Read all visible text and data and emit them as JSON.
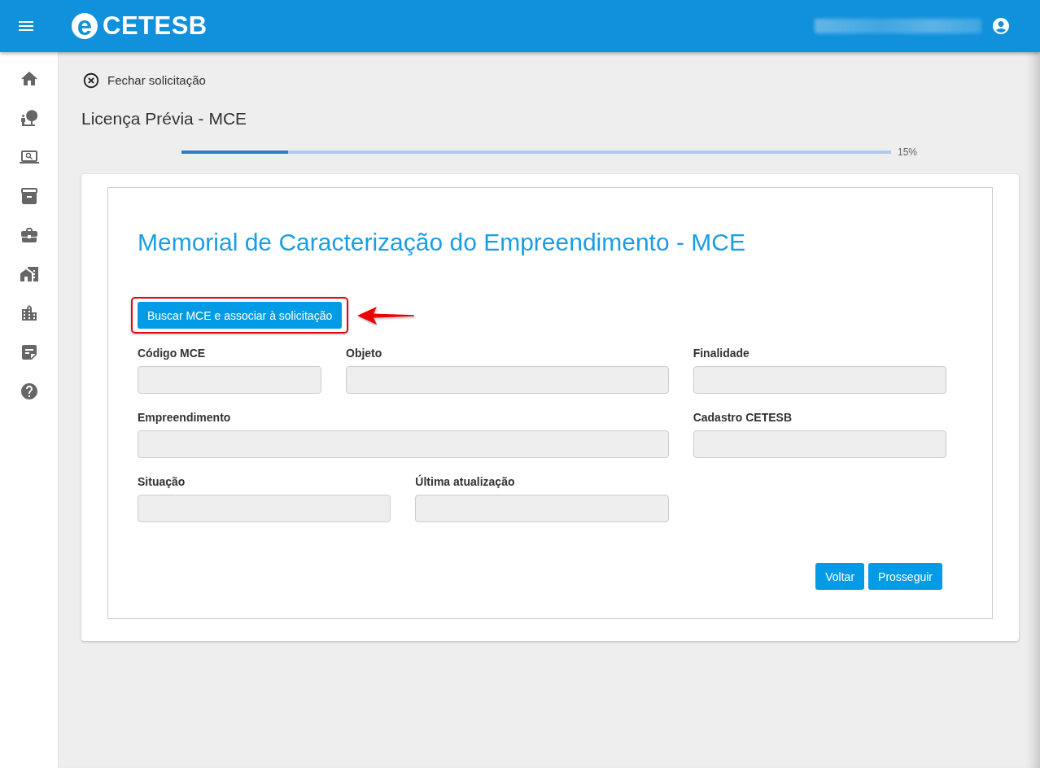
{
  "header": {
    "logo": {
      "mark": "e",
      "name": "CETESB"
    },
    "account": {
      "email_blurred": true
    }
  },
  "close_link": {
    "label": "Fechar solicitação"
  },
  "page_title": "Licença Prévia - MCE",
  "progress": {
    "level": 0.15,
    "reading": "15%"
  },
  "form": {
    "title": "Memorial de Caracterização do Empreendimento - MCE",
    "search_button": {
      "label": "Buscar MCE e associar à solicitação",
      "highlighted": true
    },
    "rows": [
      {
        "fields": [
          {
            "label": "Código MCE",
            "disabled": true
          },
          {
            "label": "Objeto",
            "disabled": true
          },
          {
            "label": "Finalidade",
            "disabled": true
          }
        ]
      },
      {
        "fields": [
          {
            "label": "Empreendimento",
            "disabled": true
          },
          {
            "label": "Cadastro CETESB",
            "disabled": true
          }
        ]
      },
      {
        "fields": [
          {
            "label": "Situação",
            "disabled": true
          },
          {
            "label": "Última atualização",
            "disabled": true
          }
        ]
      }
    ],
    "buttons": [
      "Voltar",
      "Prosseguir"
    ]
  }
}
